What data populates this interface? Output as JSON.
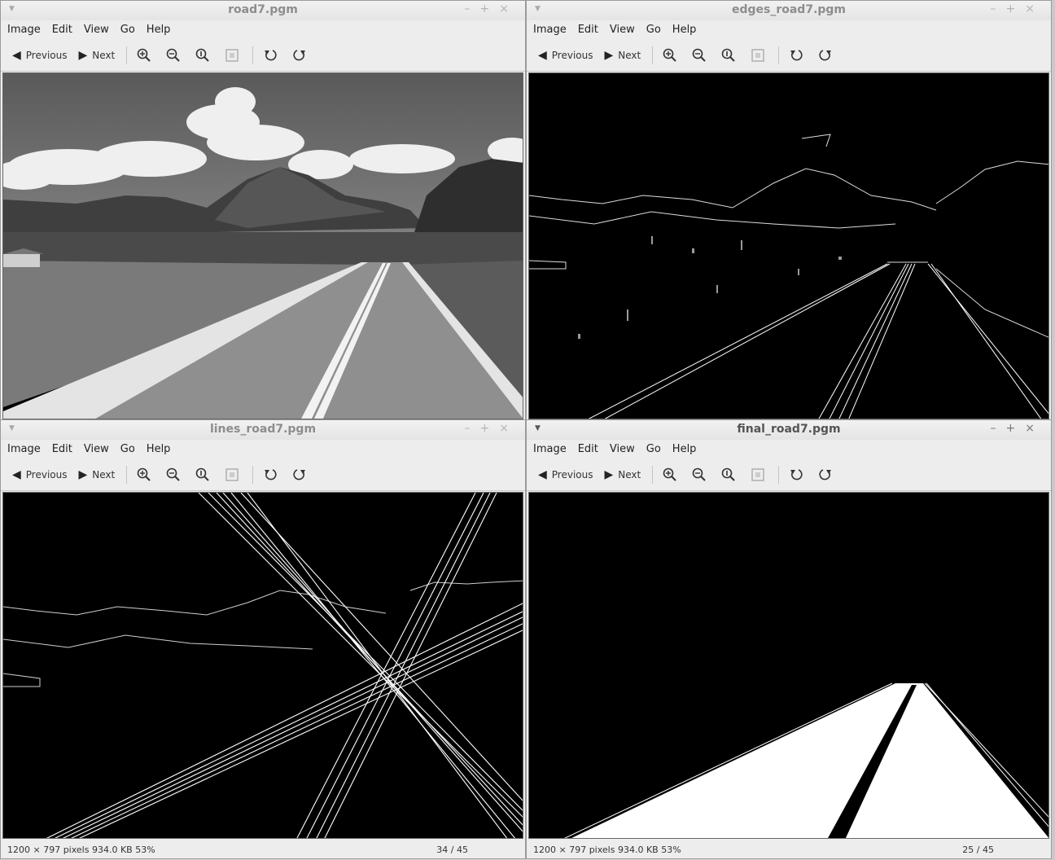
{
  "menu": [
    "Image",
    "Edit",
    "View",
    "Go",
    "Help"
  ],
  "toolbar": {
    "previous": "Previous",
    "next": "Next"
  },
  "windows": [
    {
      "title": "road7.pgm"
    },
    {
      "title": "edges_road7.pgm"
    },
    {
      "title": "lines_road7.pgm",
      "status_info": "1200 × 797 pixels  934.0 KB   53%",
      "status_index": "34 / 45"
    },
    {
      "title": "final_road7.pgm",
      "status_info": "1200 × 797 pixels  934.0 KB   53%",
      "status_index": "25 / 45"
    }
  ]
}
